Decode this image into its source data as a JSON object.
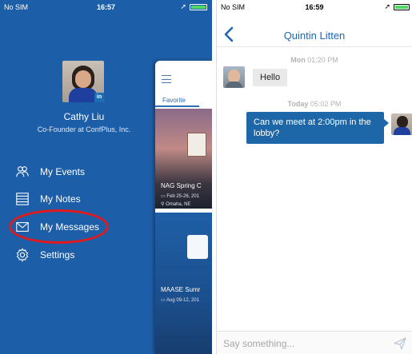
{
  "left_phone": {
    "status_bar": {
      "carrier": "No SIM",
      "time": "16:57"
    },
    "profile": {
      "name": "Cathy Liu",
      "title": "Co-Founder at ConfPlus, Inc.",
      "badge": "in"
    },
    "menu": [
      {
        "label": "My Events",
        "icon": "events-icon"
      },
      {
        "label": "My Notes",
        "icon": "notes-icon"
      },
      {
        "label": "My Messages",
        "icon": "envelope-icon",
        "highlighted": true
      },
      {
        "label": "Settings",
        "icon": "gear-icon"
      }
    ],
    "preview": {
      "tab": "Favorite",
      "event1": {
        "title": "NAG Spring C",
        "date": "Feb 25-26, 201",
        "location": "Omaha, NE"
      },
      "event2": {
        "title": "MAASE Sumr",
        "date": "Aug 09-12, 201"
      }
    },
    "colors": {
      "drawer_bg": "#1d5ea8",
      "highlight_ring": "#e2191d"
    }
  },
  "right_phone": {
    "status_bar": {
      "carrier": "No SIM",
      "time": "16:59"
    },
    "header": {
      "contact_name": "Quintin Litten"
    },
    "messages": [
      {
        "day": "Mon",
        "time": "01:20 PM",
        "text": "Hello",
        "direction": "incoming"
      },
      {
        "day": "Today",
        "time": "05:02 PM",
        "text": "Can we meet at 2:00pm in the lobby?",
        "direction": "outgoing"
      }
    ],
    "composer": {
      "placeholder": "Say something...",
      "value": ""
    },
    "colors": {
      "accent": "#1d66b4",
      "outgoing_bubble": "#1d66a8",
      "incoming_bubble": "#e9e9e9"
    }
  }
}
